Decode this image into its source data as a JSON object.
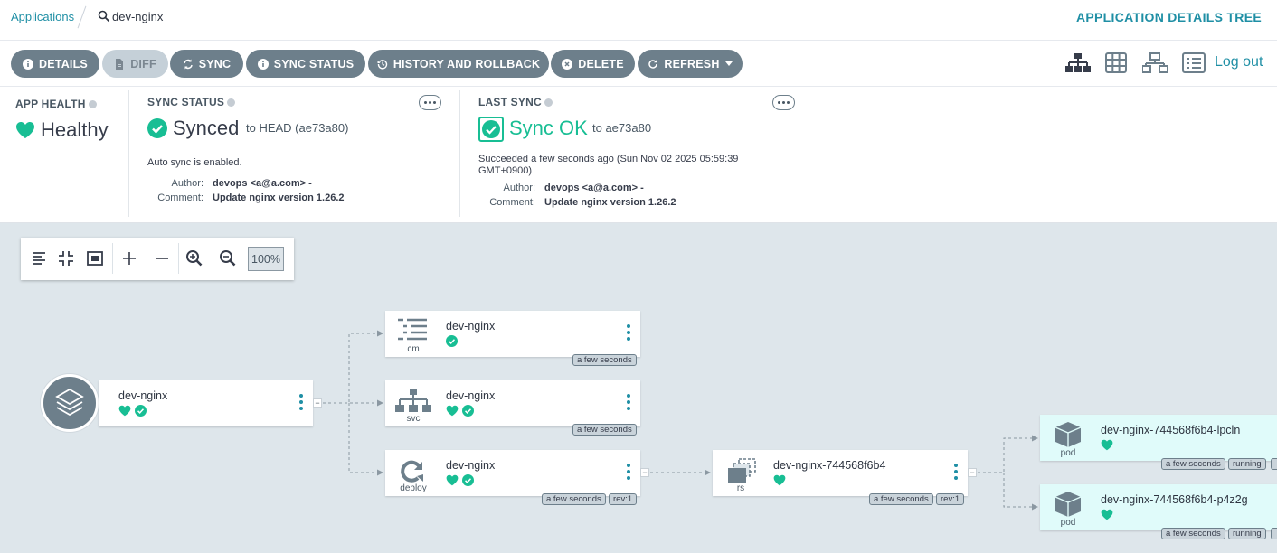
{
  "breadcrumb": {
    "applications": "Applications",
    "current": "dev-nginx"
  },
  "page_title": "APPLICATION DETAILS TREE",
  "toolbar": {
    "details": "DETAILS",
    "diff": "DIFF",
    "sync": "SYNC",
    "sync_status": "SYNC STATUS",
    "history": "HISTORY AND ROLLBACK",
    "delete": "DELETE",
    "refresh": "REFRESH",
    "logout": "Log out"
  },
  "app_health": {
    "label": "APP HEALTH",
    "value": "Healthy"
  },
  "sync_status": {
    "label": "SYNC STATUS",
    "value": "Synced",
    "target": "to HEAD (ae73a80)",
    "auto_sync": "Auto sync is enabled.",
    "author_label": "Author:",
    "author": "devops <a@a.com> -",
    "comment_label": "Comment:",
    "comment": "Update nginx version 1.26.2"
  },
  "last_sync": {
    "label": "LAST SYNC",
    "value": "Sync OK",
    "target": "to ae73a80",
    "succeeded_line1": "Succeeded a few seconds ago (Sun Nov 02 2025 05:59:39",
    "succeeded_line2": "GMT+0900)",
    "author_label": "Author:",
    "author": "devops <a@a.com> -",
    "comment_label": "Comment:",
    "comment": "Update nginx version 1.26.2"
  },
  "zoom": {
    "level": "100%"
  },
  "colors": {
    "accent": "#1f8fa5",
    "healthy": "#18be94",
    "button": "#6d7f8b",
    "canvas": "#dee6eb",
    "pod_bg": "#e0fbfa"
  },
  "tree": {
    "app": {
      "name": "dev-nginx"
    },
    "cm": {
      "name": "dev-nginx",
      "kind": "cm",
      "age": "a few seconds"
    },
    "svc": {
      "name": "dev-nginx",
      "kind": "svc",
      "age": "a few seconds"
    },
    "deploy": {
      "name": "dev-nginx",
      "kind": "deploy",
      "age": "a few seconds",
      "rev": "rev:1"
    },
    "rs": {
      "name": "dev-nginx-744568f6b4",
      "kind": "rs",
      "age": "a few seconds",
      "rev": "rev:1"
    },
    "pod1": {
      "name": "dev-nginx-744568f6b4-lpcln",
      "kind": "pod",
      "age": "a few seconds",
      "state": "running"
    },
    "pod2": {
      "name": "dev-nginx-744568f6b4-p4z2g",
      "kind": "pod",
      "age": "a few seconds",
      "state": "running"
    }
  }
}
